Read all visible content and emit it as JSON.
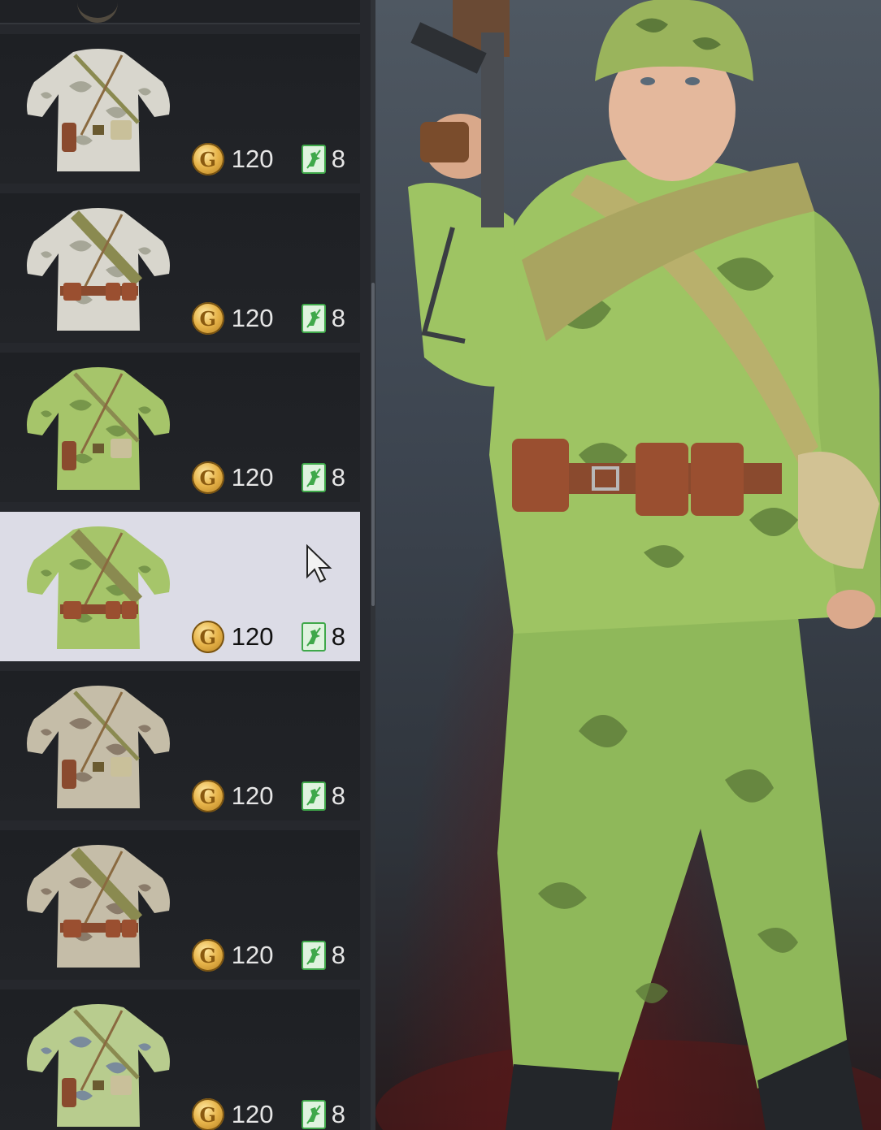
{
  "items": [
    {
      "variant": "white-camo-holster",
      "price_gold": "120",
      "price_tickets": "8",
      "selected": false
    },
    {
      "variant": "white-camo-belt-pouches",
      "price_gold": "120",
      "price_tickets": "8",
      "selected": false
    },
    {
      "variant": "green-camo-holster",
      "price_gold": "120",
      "price_tickets": "8",
      "selected": false
    },
    {
      "variant": "green-camo-belt-pouches",
      "price_gold": "120",
      "price_tickets": "8",
      "selected": true
    },
    {
      "variant": "brown-camo-holster",
      "price_gold": "120",
      "price_tickets": "8",
      "selected": false
    },
    {
      "variant": "brown-camo-belt-pouches",
      "price_gold": "120",
      "price_tickets": "8",
      "selected": false
    },
    {
      "variant": "forest-camo-holster",
      "price_gold": "120",
      "price_tickets": "8",
      "selected": false
    }
  ],
  "icons": {
    "gold": "gold-coin-icon",
    "ticket": "ticket-icon",
    "cursor": "mouse-cursor-icon"
  },
  "colors": {
    "panel_bg": "#26282d",
    "selected_bg": "#dcdce6",
    "gold": "#e7b44a",
    "ticket_green": "#3fa84a"
  }
}
